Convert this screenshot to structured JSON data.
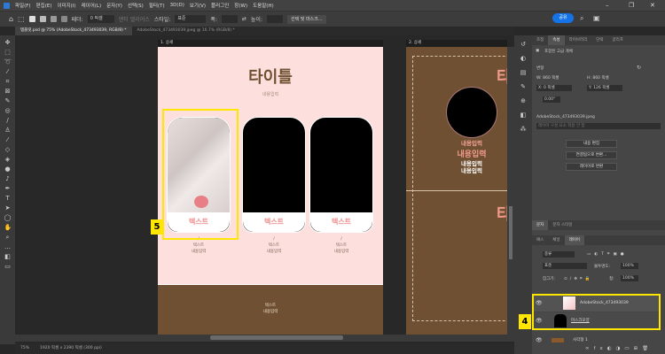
{
  "menu": [
    "파일(F)",
    "편집(E)",
    "이미지(I)",
    "레이어(L)",
    "문자(Y)",
    "선택(S)",
    "필터(T)",
    "3D(D)",
    "보기(V)",
    "플러그인",
    "창(W)",
    "도움말(H)"
  ],
  "window_controls": {
    "minimize": "–",
    "restore": "❐",
    "close": "✕"
  },
  "options": {
    "feather_label": "페더:",
    "feather_value": "0 픽셀",
    "antialias": "앤티 앨리어스",
    "style_label": "스타일:",
    "style_value": "표준",
    "width_label": "폭:",
    "height_label": "높이:",
    "select_mask": "선택 및 마스크...",
    "share": "공유"
  },
  "tabs": [
    "템플릿.psd @ 75% (AdobeStock_473493039, RGB/8) *",
    "AdobeStock_473493039.jpeg @ 16.7% (RGB/8) *"
  ],
  "doc1": {
    "label": "1. 상세",
    "title": "타이틀",
    "subtitle": "내용입력",
    "cards": [
      {
        "caption": "텍스트",
        "line1": "텍스트",
        "line2": "내용입력"
      },
      {
        "caption": "텍스트",
        "line1": "텍스트",
        "line2": "내용입력"
      },
      {
        "caption": "텍스트",
        "line1": "텍스트",
        "line2": "내용입력"
      }
    ],
    "footer_line1": "텍스트",
    "footer_line2": "내용입력"
  },
  "doc2": {
    "label": "2. 상세",
    "title_char": "타",
    "small": "내용입력",
    "big": "내용입력",
    "line1": "내용입력",
    "line2": "내용입력"
  },
  "annotations": {
    "five": "5",
    "four": "4"
  },
  "status": {
    "zoom": "75%",
    "size": "1920 픽셀 x 2390 픽셀 (300 ppi)"
  },
  "properties": {
    "tabs": [
      "조정",
      "속성",
      "라이브러리",
      "단락",
      "글리프"
    ],
    "kind": "포함된 고급 개체",
    "transform": "변형",
    "w": "W: 860 픽셀",
    "h": "H: 860 픽셀",
    "x": "X: 0 픽셀",
    "y": "Y: 126 픽셀",
    "angle": "0.00°",
    "file": "AdobeStock_473493039.jpeg",
    "comp": "레이어 구성 요소 적용 안 함",
    "buttons": [
      "내용 편집",
      "연결됨으로 변환...",
      "레이어로 변환"
    ]
  },
  "layers": {
    "tabs_top": [
      "문자",
      "문자 스타일"
    ],
    "tabs": [
      "패스",
      "채널",
      "레이어"
    ],
    "filter": "종류",
    "blend": "표준",
    "opacity_label": "불투명도:",
    "opacity": "100%",
    "lock_label": "잠그기:",
    "fill_label": "칠:",
    "fill": "100%",
    "items": [
      "AdobeStock_473493039",
      "마스크모양",
      "사각형 1"
    ]
  }
}
